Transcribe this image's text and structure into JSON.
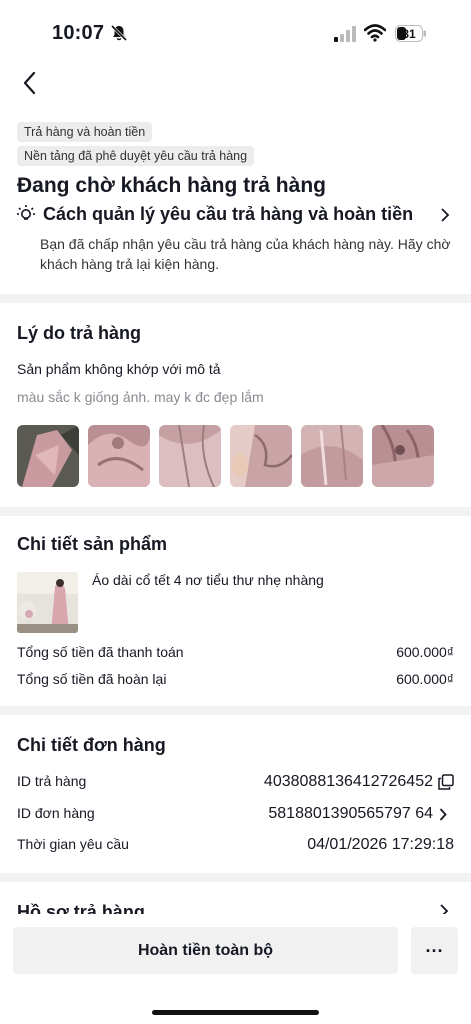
{
  "status_bar": {
    "time": "10:07",
    "battery": "31",
    "icons": [
      "bell-mute-icon",
      "cellular-signal-icon",
      "wifi-icon",
      "battery-icon"
    ]
  },
  "nav": {
    "back_icon": "chevron-left-icon"
  },
  "status_card": {
    "chip_type": "Trả hàng và hoàn tiền",
    "chip_platform": "Nền tảng đã phê duyệt yêu cầu trả hàng",
    "title": "Đang chờ khách hàng trả hàng",
    "guide_label": "Cách quản lý yêu cầu trả hàng và hoàn tiền",
    "description": "Bạn đã chấp nhận yêu cầu trả hàng của khách hàng này. Hãy chờ khách hàng trả lại kiện hàng."
  },
  "reason_card": {
    "title": "Lý do trả hàng",
    "reason": "Sản phẩm không khớp với mô tả",
    "note": "màu sắc k giống ảnh. may k đc đẹp lắm",
    "photo_count": 6
  },
  "product_card": {
    "title": "Chi tiết sản phẩm",
    "product_name": "Áo dài cổ tết 4 nơ tiểu thư nhẹ nhàng",
    "paid_label": "Tổng số tiền đã thanh toán",
    "paid_value": "600.000₫",
    "refunded_label": "Tổng số tiền đã hoàn lại",
    "refunded_value": "600.000₫"
  },
  "order_card": {
    "title": "Chi tiết đơn hàng",
    "return_id_label": "ID trả hàng",
    "return_id_value": "4038088136412726452",
    "order_id_label": "ID đơn hàng",
    "order_id_value": "5818801390565797 64",
    "request_time_label": "Thời gian yêu cầu",
    "request_time_value": "04/01/2026 17:29:18"
  },
  "profile_card": {
    "title": "Hồ sơ trả hàng"
  },
  "bottom": {
    "refund_button": "Hoàn tiền toàn bộ",
    "more_button": "···"
  },
  "colors": {
    "text_primary": "#161823",
    "text_secondary": "#8a8b91",
    "background": "#f2f2f2",
    "card": "#ffffff",
    "chip": "#ececec"
  }
}
